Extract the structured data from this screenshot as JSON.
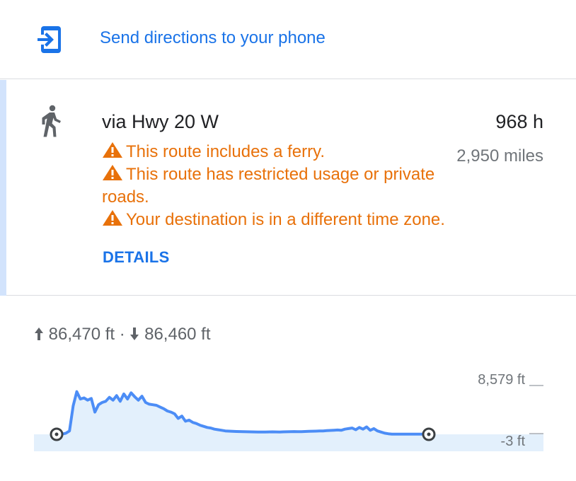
{
  "send": {
    "label": "Send directions to your phone",
    "icon": "send-to-phone-icon"
  },
  "route": {
    "mode_icon": "walking-icon",
    "name": "via Hwy 20 W",
    "time": "968 h",
    "distance": "2,950 miles",
    "warnings": [
      "This route includes a ferry.",
      "This route has restricted usage or private roads.",
      "Your destination is in a different time zone."
    ],
    "warning_icon": "warning-triangle-icon",
    "details_label": "DETAILS"
  },
  "elevation": {
    "ascent": "86,470 ft",
    "separator": "·",
    "descent": "86,460 ft",
    "max_label": "8,579 ft",
    "min_label": "-3 ft"
  },
  "colors": {
    "link_blue": "#1a73e8",
    "warning_orange": "#e8710a",
    "profile_fill": "#e3f0fc",
    "profile_line": "#4c8df6",
    "accent_bar": "#d2e3fc"
  },
  "chart_data": {
    "type": "area",
    "ylim": [
      -3,
      8579
    ],
    "x": [
      0,
      1,
      2,
      3,
      4,
      5,
      6,
      7,
      8,
      9,
      10,
      11,
      12,
      13,
      14,
      15,
      16,
      17,
      18,
      19,
      20,
      21,
      22,
      23,
      24,
      25,
      26,
      27,
      28,
      29,
      30,
      31,
      32,
      33,
      34,
      35,
      36,
      37,
      38,
      39,
      40,
      41,
      42,
      43,
      44,
      45,
      46,
      47,
      48,
      49,
      50,
      51,
      52,
      53,
      54,
      55,
      56,
      57,
      58,
      59,
      60,
      61,
      62,
      63,
      64,
      65,
      66,
      67,
      68,
      69,
      70,
      71,
      72,
      73,
      74,
      75,
      76,
      77,
      78,
      79,
      80,
      81,
      82,
      83,
      84,
      85,
      86,
      87,
      88,
      89,
      90,
      91,
      92,
      93,
      94,
      95,
      96,
      97,
      98,
      99,
      100
    ],
    "y": [
      30,
      200,
      600,
      5000,
      7500,
      6200,
      6400,
      6000,
      6300,
      3900,
      5200,
      5600,
      5800,
      6500,
      6000,
      6800,
      5800,
      7100,
      6200,
      7300,
      6600,
      6000,
      6700,
      5600,
      5300,
      5200,
      5100,
      4800,
      4500,
      4100,
      3900,
      3600,
      2800,
      3200,
      2300,
      2500,
      2100,
      1900,
      1600,
      1400,
      1200,
      1100,
      900,
      800,
      700,
      600,
      560,
      520,
      500,
      480,
      460,
      440,
      430,
      420,
      410,
      400,
      410,
      420,
      430,
      420,
      410,
      430,
      450,
      470,
      480,
      460,
      470,
      500,
      520,
      540,
      560,
      580,
      600,
      640,
      680,
      720,
      760,
      700,
      900,
      1000,
      1100,
      800,
      1200,
      900,
      1300,
      700,
      1000,
      600,
      400,
      200,
      100,
      30,
      30,
      30,
      30,
      30,
      30,
      30,
      30,
      30,
      30
    ]
  }
}
